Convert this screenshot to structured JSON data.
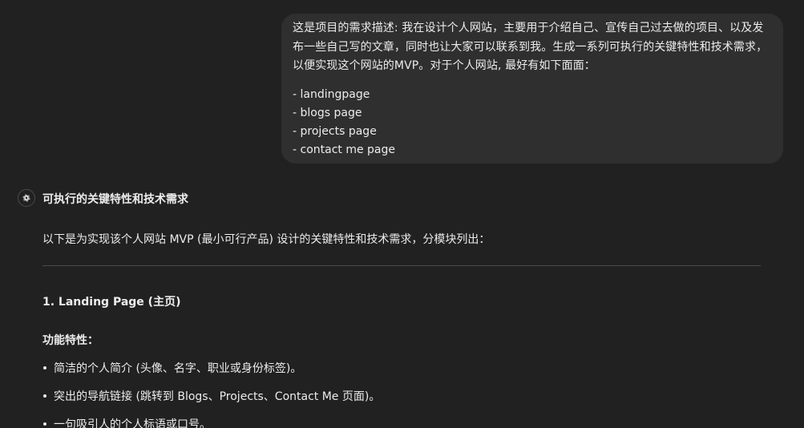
{
  "user_message": {
    "lines": [
      "这是项目的需求描述: 我在设计个人网站，主要用于介绍自己、宣传自己过去做的项目、以及发",
      "布一些自己写的文章，同时也让大家可以联系到我。生成一系列可执行的关键特性和技术需求，",
      "以便实现这个网站的MVP。对于个人网站, 最好有如下面面："
    ],
    "list": [
      "- landingpage",
      "- blogs page",
      "- projects page",
      "- contact me page"
    ]
  },
  "assistant": {
    "icon": "openai-logo-icon",
    "heading": "可执行的关键特性和技术需求",
    "intro": "以下是为实现该个人网站 MVP (最小可行产品) 设计的关键特性和技术需求，分模块列出：",
    "section_title": "1. Landing Page (主页)",
    "subsection_title": "功能特性：",
    "bullets": [
      "简洁的个人简介 (头像、名字、职业或身份标签)。",
      "突出的导航链接 (跳转到 Blogs、Projects、Contact Me 页面)。",
      "一句吸引人的个人标语或口号。"
    ]
  },
  "colors": {
    "background": "#212121",
    "bubble": "#2f2f2f",
    "text": "#ececec",
    "divider": "#4a4a4a"
  }
}
